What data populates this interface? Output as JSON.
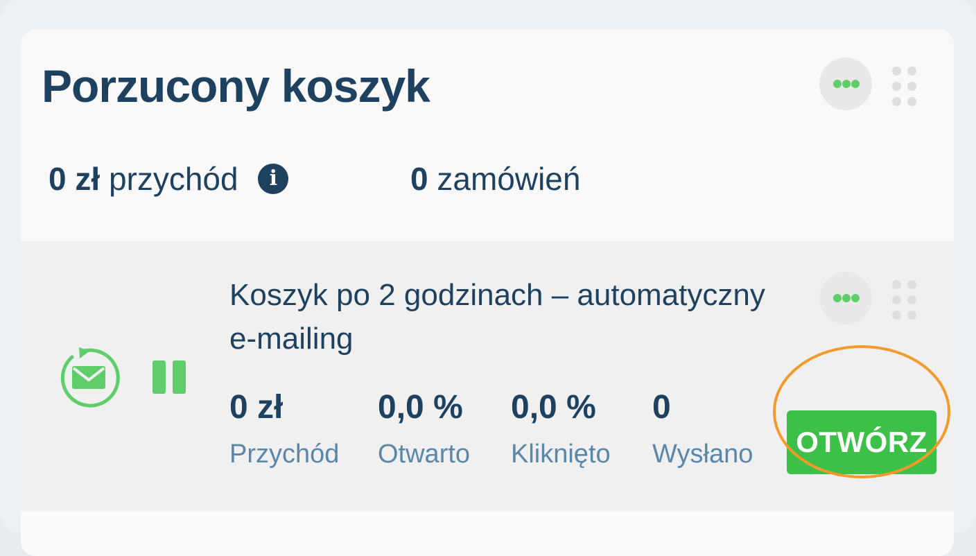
{
  "header": {
    "title": "Porzucony koszyk"
  },
  "summary": {
    "revenue_value": "0 zł",
    "revenue_label": "przychód",
    "info_icon": "i",
    "orders_value": "0",
    "orders_label": "zamówień"
  },
  "flow": {
    "name": "Koszyk po 2 godzinach – automatyczny e-mailing",
    "status": "paused",
    "metrics": [
      {
        "value": "0 zł",
        "label": "Przychód"
      },
      {
        "value": "0,0 %",
        "label": "Otwarto"
      },
      {
        "value": "0,0 %",
        "label": "Kliknięto"
      },
      {
        "value": "0",
        "label": "Wysłano"
      }
    ],
    "open_label": "OTWÓRZ"
  },
  "icons": {
    "menu": "more-horizontal-icon",
    "drag": "drag-handle-icon",
    "mail": "email-refresh-icon",
    "pause": "pause-icon",
    "info": "info-icon"
  },
  "colors": {
    "primary_text": "#1e4160",
    "label_text": "#5a86a8",
    "accent_green": "#3dc047",
    "icon_green": "#5fcd6a",
    "highlight_orange": "#f29a2c"
  }
}
